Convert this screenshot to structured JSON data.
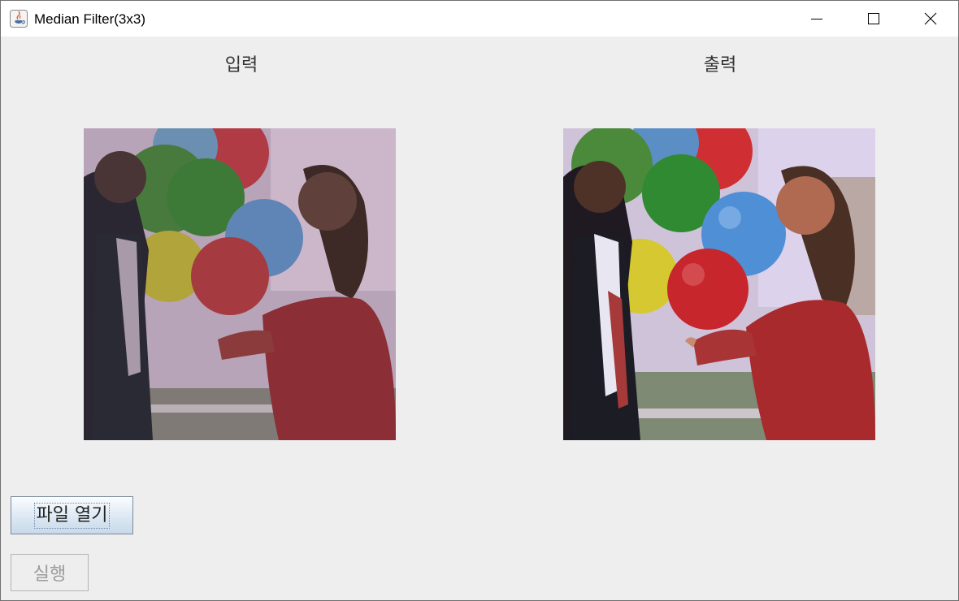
{
  "window": {
    "title": "Median Filter(3x3)",
    "controls": {
      "minimize": "minimize-icon",
      "maximize": "maximize-icon",
      "close": "close-icon"
    }
  },
  "panels": {
    "input": {
      "label": "입력"
    },
    "output": {
      "label": "출력"
    }
  },
  "buttons": {
    "open_file": "파일 열기",
    "run": "실행"
  },
  "colors": {
    "window_bg": "#eeeeee",
    "titlebar_bg": "#ffffff"
  }
}
